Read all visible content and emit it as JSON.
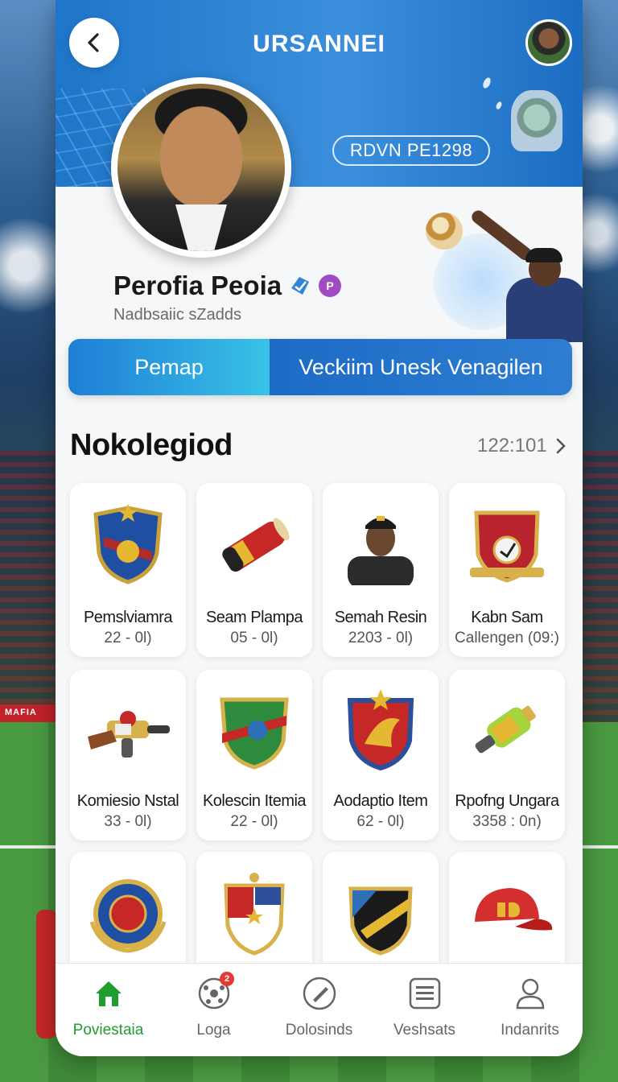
{
  "header": {
    "title": "URSANNEI",
    "id_pill": "RDVN PE1298"
  },
  "profile": {
    "name": "Perofia Peoia",
    "subtitle": "Nadbsaiic sZadds"
  },
  "tabs": [
    {
      "label": "Pemap",
      "active": true
    },
    {
      "label": "Veckiim Unesk Venagilen",
      "active": false
    }
  ],
  "section": {
    "title": "Nokolegiod",
    "count": "122:101"
  },
  "items": [
    {
      "name": "Pemslviamra",
      "meta": "22 - 0l)",
      "icon": "crest-shield-blue-icon"
    },
    {
      "name": "Seam Plampa",
      "meta": "05 - 0l)",
      "icon": "capsule-item-icon"
    },
    {
      "name": "Semah Resin",
      "meta": "2203 - 0l)",
      "icon": "coach-portrait-icon"
    },
    {
      "name": "Kabn Sam",
      "meta": "Callengen (09:)",
      "icon": "crest-shield-red-icon"
    },
    {
      "name": "Komiesio Nstal",
      "meta": "33 - 0l)",
      "icon": "blaster-gun-icon"
    },
    {
      "name": "Kolescin Itemia",
      "meta": "22 - 0l)",
      "icon": "crest-shield-green-icon"
    },
    {
      "name": "Aodaptio Item",
      "meta": "62 - 0l)",
      "icon": "eagle-crest-icon"
    },
    {
      "name": "Rpofng Ungara",
      "meta": "3358 : 0n)",
      "icon": "spray-bottle-icon"
    },
    {
      "name": "",
      "meta": "",
      "icon": "laurel-badge-icon"
    },
    {
      "name": "",
      "meta": "",
      "icon": "flag-shield-icon"
    },
    {
      "name": "",
      "meta": "",
      "icon": "striped-shield-icon"
    },
    {
      "name": "",
      "meta": "",
      "icon": "red-cap-icon"
    }
  ],
  "nav": [
    {
      "label": "Poviestaia",
      "icon": "home-icon",
      "active": true
    },
    {
      "label": "Loga",
      "icon": "ball-icon",
      "active": false,
      "badge": "2"
    },
    {
      "label": "Dolosinds",
      "icon": "edit-icon",
      "active": false
    },
    {
      "label": "Veshsats",
      "icon": "list-icon",
      "active": false
    },
    {
      "label": "Indanrits",
      "icon": "person-icon",
      "active": false
    }
  ],
  "colors": {
    "primary": "#1e75c9",
    "accent_cyan": "#38c2e6",
    "active_nav": "#1f9d2e",
    "badge": "#a14bc0"
  }
}
